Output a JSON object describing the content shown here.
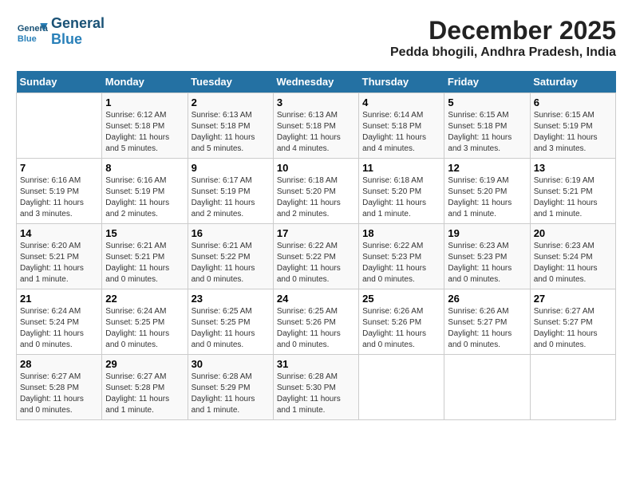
{
  "logo": {
    "line1": "General",
    "line2": "Blue"
  },
  "title": {
    "month": "December 2025",
    "location": "Pedda bhogili, Andhra Pradesh, India"
  },
  "headers": [
    "Sunday",
    "Monday",
    "Tuesday",
    "Wednesday",
    "Thursday",
    "Friday",
    "Saturday"
  ],
  "weeks": [
    [
      {
        "day": "",
        "detail": ""
      },
      {
        "day": "1",
        "detail": "Sunrise: 6:12 AM\nSunset: 5:18 PM\nDaylight: 11 hours\nand 5 minutes."
      },
      {
        "day": "2",
        "detail": "Sunrise: 6:13 AM\nSunset: 5:18 PM\nDaylight: 11 hours\nand 5 minutes."
      },
      {
        "day": "3",
        "detail": "Sunrise: 6:13 AM\nSunset: 5:18 PM\nDaylight: 11 hours\nand 4 minutes."
      },
      {
        "day": "4",
        "detail": "Sunrise: 6:14 AM\nSunset: 5:18 PM\nDaylight: 11 hours\nand 4 minutes."
      },
      {
        "day": "5",
        "detail": "Sunrise: 6:15 AM\nSunset: 5:18 PM\nDaylight: 11 hours\nand 3 minutes."
      },
      {
        "day": "6",
        "detail": "Sunrise: 6:15 AM\nSunset: 5:19 PM\nDaylight: 11 hours\nand 3 minutes."
      }
    ],
    [
      {
        "day": "7",
        "detail": "Sunrise: 6:16 AM\nSunset: 5:19 PM\nDaylight: 11 hours\nand 3 minutes."
      },
      {
        "day": "8",
        "detail": "Sunrise: 6:16 AM\nSunset: 5:19 PM\nDaylight: 11 hours\nand 2 minutes."
      },
      {
        "day": "9",
        "detail": "Sunrise: 6:17 AM\nSunset: 5:19 PM\nDaylight: 11 hours\nand 2 minutes."
      },
      {
        "day": "10",
        "detail": "Sunrise: 6:18 AM\nSunset: 5:20 PM\nDaylight: 11 hours\nand 2 minutes."
      },
      {
        "day": "11",
        "detail": "Sunrise: 6:18 AM\nSunset: 5:20 PM\nDaylight: 11 hours\nand 1 minute."
      },
      {
        "day": "12",
        "detail": "Sunrise: 6:19 AM\nSunset: 5:20 PM\nDaylight: 11 hours\nand 1 minute."
      },
      {
        "day": "13",
        "detail": "Sunrise: 6:19 AM\nSunset: 5:21 PM\nDaylight: 11 hours\nand 1 minute."
      }
    ],
    [
      {
        "day": "14",
        "detail": "Sunrise: 6:20 AM\nSunset: 5:21 PM\nDaylight: 11 hours\nand 1 minute."
      },
      {
        "day": "15",
        "detail": "Sunrise: 6:21 AM\nSunset: 5:21 PM\nDaylight: 11 hours\nand 0 minutes."
      },
      {
        "day": "16",
        "detail": "Sunrise: 6:21 AM\nSunset: 5:22 PM\nDaylight: 11 hours\nand 0 minutes."
      },
      {
        "day": "17",
        "detail": "Sunrise: 6:22 AM\nSunset: 5:22 PM\nDaylight: 11 hours\nand 0 minutes."
      },
      {
        "day": "18",
        "detail": "Sunrise: 6:22 AM\nSunset: 5:23 PM\nDaylight: 11 hours\nand 0 minutes."
      },
      {
        "day": "19",
        "detail": "Sunrise: 6:23 AM\nSunset: 5:23 PM\nDaylight: 11 hours\nand 0 minutes."
      },
      {
        "day": "20",
        "detail": "Sunrise: 6:23 AM\nSunset: 5:24 PM\nDaylight: 11 hours\nand 0 minutes."
      }
    ],
    [
      {
        "day": "21",
        "detail": "Sunrise: 6:24 AM\nSunset: 5:24 PM\nDaylight: 11 hours\nand 0 minutes."
      },
      {
        "day": "22",
        "detail": "Sunrise: 6:24 AM\nSunset: 5:25 PM\nDaylight: 11 hours\nand 0 minutes."
      },
      {
        "day": "23",
        "detail": "Sunrise: 6:25 AM\nSunset: 5:25 PM\nDaylight: 11 hours\nand 0 minutes."
      },
      {
        "day": "24",
        "detail": "Sunrise: 6:25 AM\nSunset: 5:26 PM\nDaylight: 11 hours\nand 0 minutes."
      },
      {
        "day": "25",
        "detail": "Sunrise: 6:26 AM\nSunset: 5:26 PM\nDaylight: 11 hours\nand 0 minutes."
      },
      {
        "day": "26",
        "detail": "Sunrise: 6:26 AM\nSunset: 5:27 PM\nDaylight: 11 hours\nand 0 minutes."
      },
      {
        "day": "27",
        "detail": "Sunrise: 6:27 AM\nSunset: 5:27 PM\nDaylight: 11 hours\nand 0 minutes."
      }
    ],
    [
      {
        "day": "28",
        "detail": "Sunrise: 6:27 AM\nSunset: 5:28 PM\nDaylight: 11 hours\nand 0 minutes."
      },
      {
        "day": "29",
        "detail": "Sunrise: 6:27 AM\nSunset: 5:28 PM\nDaylight: 11 hours\nand 1 minute."
      },
      {
        "day": "30",
        "detail": "Sunrise: 6:28 AM\nSunset: 5:29 PM\nDaylight: 11 hours\nand 1 minute."
      },
      {
        "day": "31",
        "detail": "Sunrise: 6:28 AM\nSunset: 5:30 PM\nDaylight: 11 hours\nand 1 minute."
      },
      {
        "day": "",
        "detail": ""
      },
      {
        "day": "",
        "detail": ""
      },
      {
        "day": "",
        "detail": ""
      }
    ]
  ]
}
